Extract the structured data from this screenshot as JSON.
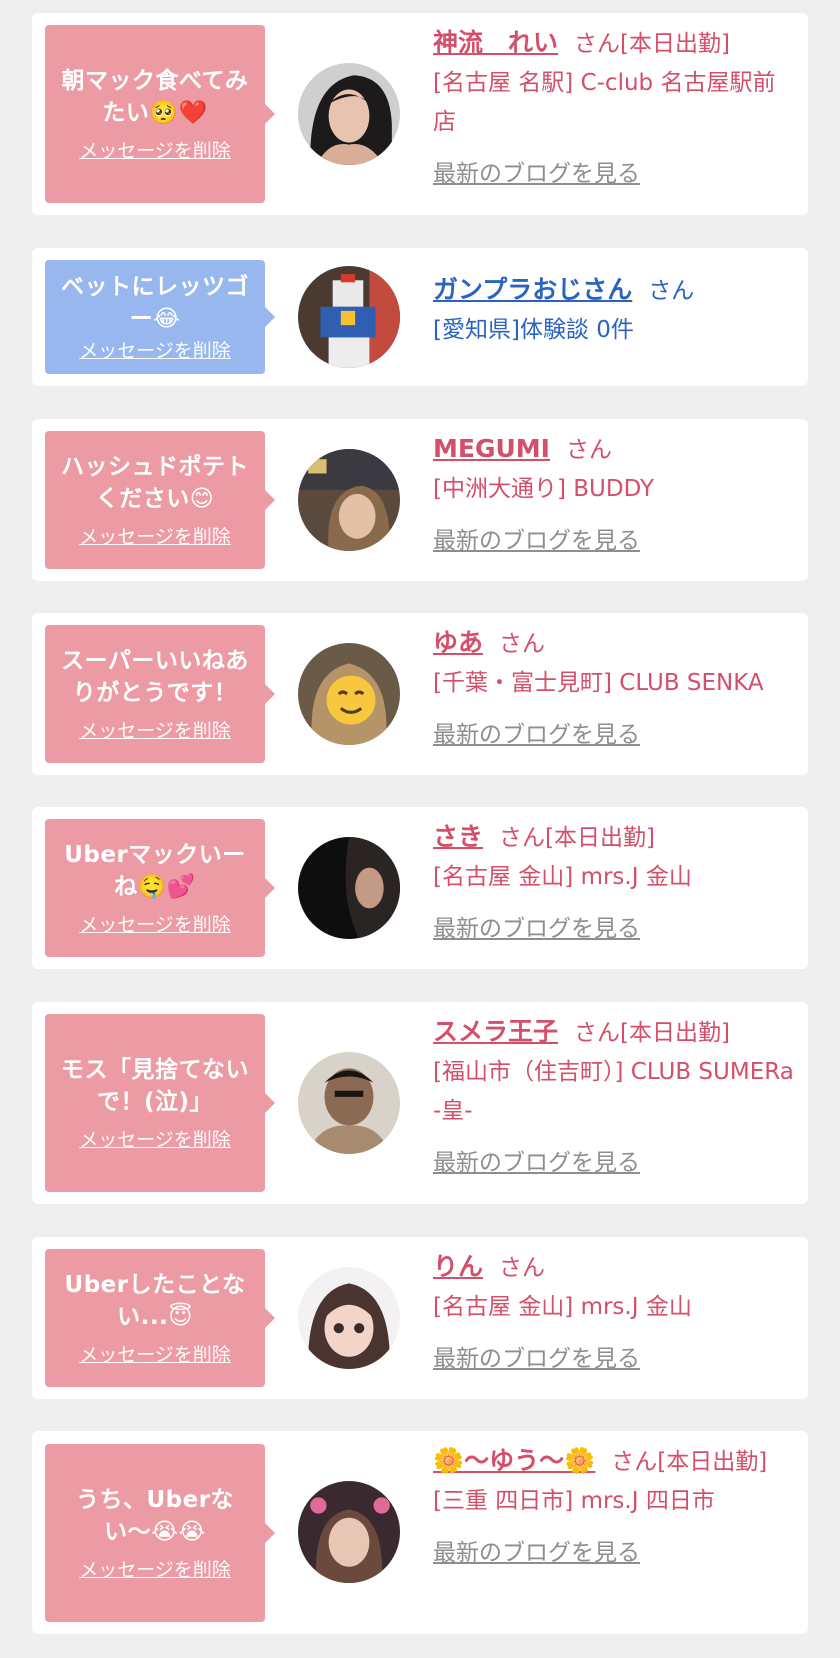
{
  "items": [
    {
      "message": "朝マック食べてみたい🥺❤️",
      "delete_label": "メッセージを削除",
      "bubble_color": "#ec9ba5",
      "name": "神流　れい",
      "suffix": "さん[本日出勤]",
      "shop": "[名古屋 名駅] C-club 名古屋駅前店",
      "blog_label": "最新のブログを見る",
      "avatar": "woman-dark-hair-avatar"
    },
    {
      "message": "ベットにレッツゴー😂",
      "delete_label": "メッセージを削除",
      "bubble_color": "#97b7ee",
      "name": "ガンプラおじさん",
      "suffix": "さん",
      "shop": "[愛知県]体験談 0件",
      "blog_label": "",
      "avatar": "robot-figure-avatar"
    },
    {
      "message": "ハッシュドポテトください😊",
      "delete_label": "メッセージを削除",
      "bubble_color": "#ec9ba5",
      "name": "MEGUMI",
      "suffix": "さん",
      "shop": "[中洲大通り] BUDDY",
      "blog_label": "最新のブログを見る",
      "avatar": "woman-selfie-avatar"
    },
    {
      "message": "スーパーいいねありがとうです！",
      "delete_label": "メッセージを削除",
      "bubble_color": "#ec9ba5",
      "name": "ゆあ",
      "suffix": "さん",
      "shop": "[千葉・富士見町] CLUB SENKA",
      "blog_label": "最新のブログを見る",
      "avatar": "smiley-face-avatar"
    },
    {
      "message": "Uberマックいーね🤤💕",
      "delete_label": "メッセージを削除",
      "bubble_color": "#ec9ba5",
      "name": "さき",
      "suffix": "さん[本日出勤]",
      "shop": "[名古屋 金山] mrs.J 金山",
      "blog_label": "最新のブログを見る",
      "avatar": "dark-profile-avatar"
    },
    {
      "message": "モス「見捨てないで！(泣)」",
      "delete_label": "メッセージを削除",
      "bubble_color": "#ec9ba5",
      "name": "スメラ王子",
      "suffix": "さん[本日出勤]",
      "shop": "[福山市（住吉町）] CLUB SUMERa -皇-",
      "blog_label": "最新のブログを見る",
      "avatar": "samurai-figure-avatar"
    },
    {
      "message": "Uberしたことない...😇",
      "delete_label": "メッセージを削除",
      "bubble_color": "#ec9ba5",
      "name": "りん",
      "suffix": "さん",
      "shop": "[名古屋 金山] mrs.J 金山",
      "blog_label": "最新のブログを見る",
      "avatar": "woman-bangs-avatar"
    },
    {
      "message": "うち、Uberない〜😭😭",
      "delete_label": "メッセージを削除",
      "bubble_color": "#ec9ba5",
      "name": "🌼〜ゆう〜🌼",
      "suffix": "さん[本日出勤]",
      "shop": "[三重 四日市] mrs.J 四日市",
      "blog_label": "最新のブログを見る",
      "avatar": "woman-filter-avatar"
    }
  ]
}
